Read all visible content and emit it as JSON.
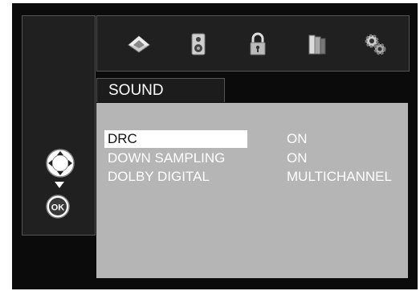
{
  "tab": {
    "label": "SOUND"
  },
  "icons": [
    "picture-icon",
    "speaker-icon",
    "lock-icon",
    "books-icon",
    "gears-icon"
  ],
  "rows": [
    {
      "label": "DRC",
      "value": "ON",
      "selected": true
    },
    {
      "label": "DOWN SAMPLING",
      "value": "ON",
      "selected": false
    },
    {
      "label": "DOLBY DIGITAL",
      "value": "MULTICHANNEL",
      "selected": false
    }
  ],
  "ok_label": "OK",
  "colors": {
    "background": "#0b0b0b",
    "panel": "#202020",
    "content": "#b5b5b5",
    "selection": "#ffffff",
    "text": "#ffffff"
  }
}
